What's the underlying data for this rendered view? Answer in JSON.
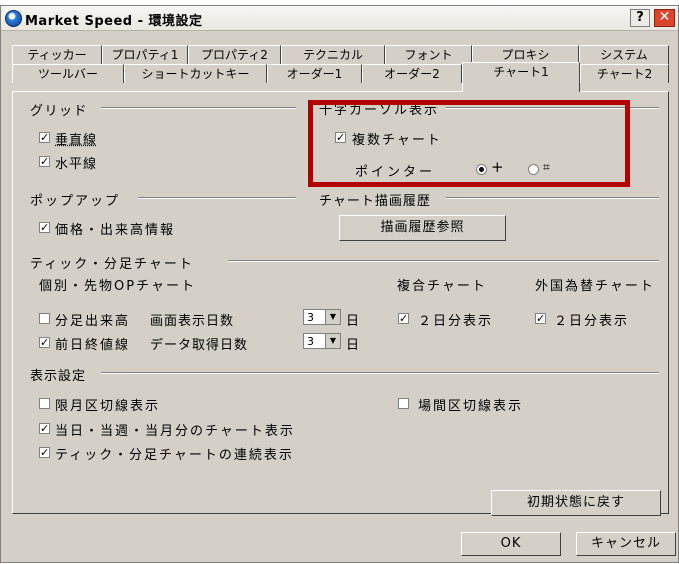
{
  "window": {
    "title": "Market Speed - 環境設定",
    "help_label": "?",
    "close_label": "✕"
  },
  "tabs_row1": [
    "ティッカー",
    "プロパティ1",
    "プロパティ2",
    "テクニカル",
    "フォント",
    "プロキシ",
    "システム"
  ],
  "tabs_row2": [
    "ツールバー",
    "ショートカットキー",
    "オーダー1",
    "オーダー2",
    "チャート1",
    "チャート2"
  ],
  "active_tab": "チャート1",
  "grid": {
    "label": "グリッド",
    "vertical": "垂直線",
    "horizontal": "水平線"
  },
  "crosshair": {
    "label": "十字カーソル表示",
    "composite": "複数チャート",
    "pointer_label": "ポインター",
    "pointer_opt1": "+",
    "pointer_opt2": "⌗"
  },
  "popup": {
    "label": "ポップアップ",
    "price_volume": "価格・出来高情報"
  },
  "history": {
    "label": "チャート描画履歴",
    "button": "描画履歴参照"
  },
  "tick": {
    "label": "ティック・分足チャート",
    "individual_label": "個別・先物OPチャート",
    "composite_label": "複合チャート",
    "fx_label": "外国為替チャート",
    "minute_volume": "分足出来高",
    "prev_close": "前日終値線",
    "display_days_label": "画面表示日数",
    "display_days_value": "3",
    "fetch_days_label": "データ取得日数",
    "fetch_days_value": "3",
    "day_unit": "日",
    "two_day_composite": "２日分表示",
    "two_day_fx": "２日分表示"
  },
  "display": {
    "label": "表示設定",
    "month_separator": "限月区切線表示",
    "session_separator": "場間区切線表示",
    "day_week_month": "当日・当週・当月分のチャート表示",
    "continuous": "ティック・分足チャートの連続表示"
  },
  "buttons": {
    "reset": "初期状態に戻す",
    "ok": "OK",
    "cancel": "キャンセル"
  },
  "colors": {
    "highlight": "#b30000",
    "dialog_bg": "#d4d0c8"
  }
}
